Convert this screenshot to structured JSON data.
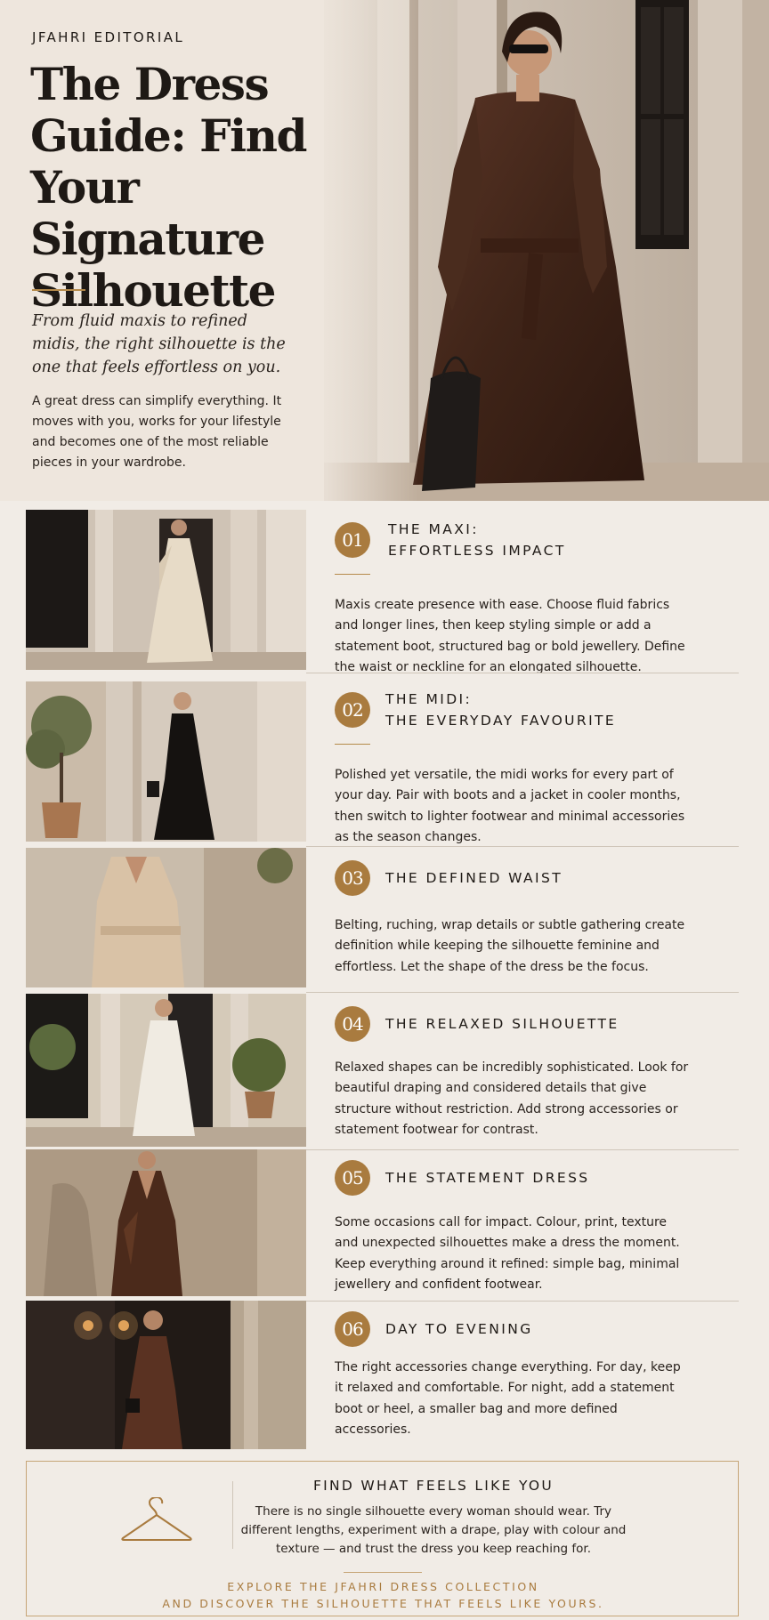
{
  "colors": {
    "accent": "#a97b3f",
    "background": "#f1ece6",
    "text": "#1f1a16",
    "rule": "#cfc5b9"
  },
  "hero": {
    "brand": "JFAHRI EDITORIAL",
    "title": "The Dress Guide: Find Your Signature Silhouette",
    "lead": "From fluid maxis to refined midis, the right silhouette is the one that feels effortless on you.",
    "body": "A great dress can simplify everything. It moves with you, works for your lifestyle and becomes one of the most reliable pieces in your wardrobe."
  },
  "sections": [
    {
      "number": "01",
      "heading_line1": "THE MAXI:",
      "heading_line2": "EFFORTLESS IMPACT",
      "text": "Maxis create presence with ease. Choose fluid fabrics and longer lines, then keep styling simple or add a statement boot, structured bag or bold jewellery. Define the waist or neckline for an elongated silhouette."
    },
    {
      "number": "02",
      "heading_line1": "THE MIDI:",
      "heading_line2": "THE EVERYDAY FAVOURITE",
      "text": "Polished yet versatile, the midi works for every part of your day. Pair with boots and a jacket in cooler months, then switch to lighter footwear and minimal accessories as the season changes."
    },
    {
      "number": "03",
      "heading_line1": "THE DEFINED WAIST",
      "text": "Belting, ruching, wrap details or subtle gathering create definition while keeping the silhouette feminine and effortless. Let the shape of the dress be the focus."
    },
    {
      "number": "04",
      "heading_line1": "THE RELAXED SILHOUETTE",
      "text": "Relaxed shapes can be incredibly sophisticated. Look for beautiful draping and considered details that give structure without restriction. Add strong accessories or statement footwear for contrast."
    },
    {
      "number": "05",
      "heading_line1": "THE STATEMENT DRESS",
      "text": "Some occasions call for impact. Colour, print, texture and unexpected silhouettes make a dress the moment. Keep everything around it refined: simple bag, minimal jewellery and confident footwear."
    },
    {
      "number": "06",
      "heading_line1": "DAY TO EVENING",
      "text": "The right accessories change everything. For day, keep it relaxed and comfortable. For night, add a statement boot or heel, a smaller bag and more defined accessories."
    }
  ],
  "cta": {
    "icon": "hanger-icon",
    "title": "FIND WHAT FEELS LIKE YOU",
    "text": "There is no single silhouette every woman should wear. Try different lengths, experiment with a drape, play with colour and texture — and trust the dress you keep reaching for.",
    "link_line1": "EXPLORE THE JFAHRI DRESS COLLECTION",
    "link_line2": "AND DISCOVER THE SILHOUETTE THAT FEELS LIKE YOURS."
  }
}
